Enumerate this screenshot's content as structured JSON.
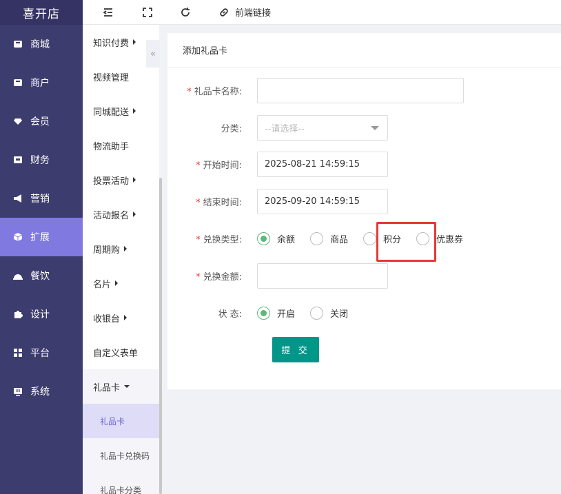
{
  "app": {
    "title": "喜开店"
  },
  "topbar": {
    "link_label": "前端链接",
    "icons": [
      "indent-icon",
      "fullscreen-icon",
      "refresh-icon",
      "link-icon"
    ]
  },
  "sidebar": {
    "items": [
      {
        "label": "商城",
        "icon": "shop-icon"
      },
      {
        "label": "商户",
        "icon": "merchant-icon"
      },
      {
        "label": "会员",
        "icon": "diamond-icon"
      },
      {
        "label": "财务",
        "icon": "wallet-icon"
      },
      {
        "label": "营销",
        "icon": "megaphone-icon"
      },
      {
        "label": "扩展",
        "icon": "cube-icon",
        "active": true
      },
      {
        "label": "餐饮",
        "icon": "dish-icon"
      },
      {
        "label": "设计",
        "icon": "puzzle-icon"
      },
      {
        "label": "平台",
        "icon": "grid-icon"
      },
      {
        "label": "系统",
        "icon": "monitor-icon"
      }
    ]
  },
  "submenu": {
    "items": [
      {
        "label": "知识付费",
        "has_children": true
      },
      {
        "label": "视频管理",
        "has_children": false
      },
      {
        "label": "同城配送",
        "has_children": true
      },
      {
        "label": "物流助手",
        "has_children": false
      },
      {
        "label": "投票活动",
        "has_children": true
      },
      {
        "label": "活动报名",
        "has_children": true
      },
      {
        "label": "周期购",
        "has_children": true
      },
      {
        "label": "名片",
        "has_children": true
      },
      {
        "label": "收银台",
        "has_children": true
      },
      {
        "label": "自定义表单",
        "has_children": false
      },
      {
        "label": "礼品卡",
        "has_children": true,
        "open": true
      }
    ],
    "children": [
      {
        "label": "礼品卡",
        "active": true
      },
      {
        "label": "礼品卡兑换码",
        "active": false
      },
      {
        "label": "礼品卡分类",
        "active": false
      }
    ],
    "collapse_glyph": "«"
  },
  "form": {
    "title": "添加礼品卡",
    "required_mark": "*",
    "name": {
      "label": "礼品卡名称:",
      "value": ""
    },
    "category": {
      "label": "分类:",
      "placeholder": "--请选择--"
    },
    "start_time": {
      "label": "开始时间:",
      "value": "2025-08-21 14:59:15"
    },
    "end_time": {
      "label": "结束时间:",
      "value": "2025-09-20 14:59:15"
    },
    "exchange_type": {
      "label": "兑换类型:",
      "options": [
        "余额",
        "商品",
        "积分",
        "优惠券"
      ],
      "selected": "余额"
    },
    "exchange_amount": {
      "label": "兑换金额:",
      "value": ""
    },
    "status": {
      "label": "状 态:",
      "options": [
        "开启",
        "关闭"
      ],
      "selected": "开启"
    },
    "submit_label": "提 交"
  },
  "colors": {
    "sidebar_bg": "#3d3c6e",
    "sidebar_active": "#7f79e0",
    "radio_checked": "#5fb878",
    "submit_bg": "#009688",
    "highlight": "#e53935"
  }
}
